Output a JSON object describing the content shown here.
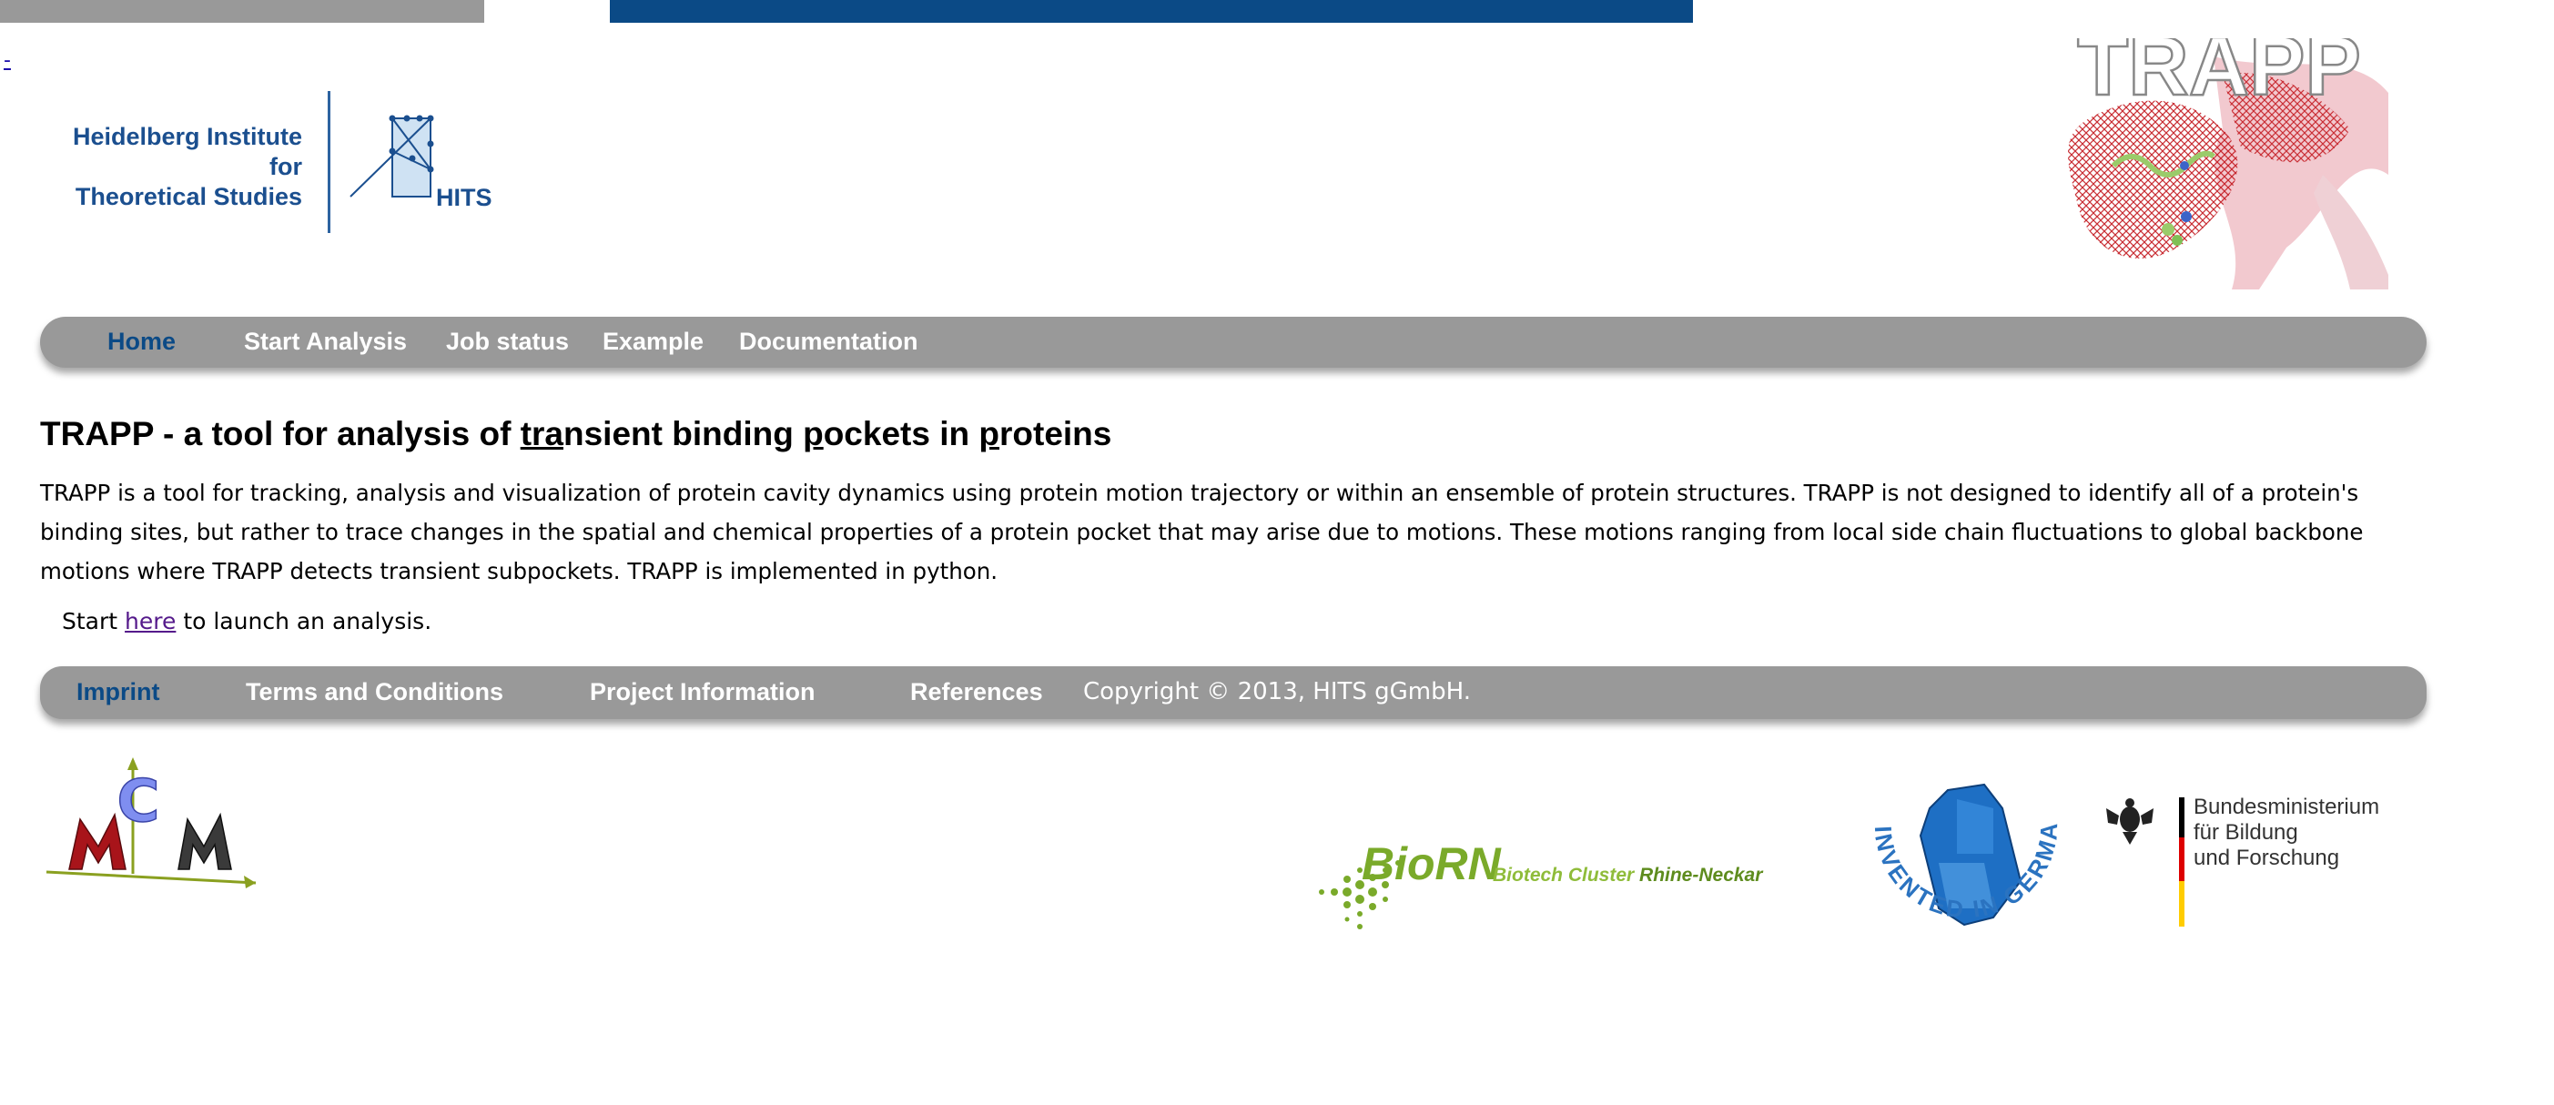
{
  "header": {
    "skip_link": "-",
    "hits_logo": {
      "line1": "Heidelberg Institute for",
      "line2": "Theoretical Studies",
      "abbrev": "HITS"
    },
    "trapp_banner": "TRAPP"
  },
  "nav": {
    "items": [
      {
        "label": "Home",
        "active": true
      },
      {
        "label": "Start Analysis",
        "active": false
      },
      {
        "label": "Job status",
        "active": false
      },
      {
        "label": "Example",
        "active": false
      },
      {
        "label": "Documentation",
        "active": false
      }
    ]
  },
  "main": {
    "title_prefix": "TRAPP - a tool for analysis of ",
    "title_u1": "tra",
    "title_mid1": "nsient binding ",
    "title_u2": "p",
    "title_mid2": "ockets in ",
    "title_u3": "p",
    "title_end": "roteins",
    "description": "TRAPP is a tool for tracking, analysis and visualization of protein cavity dynamics using protein motion trajectory or within an ensemble of protein structures. TRAPP is not designed to identify all of a protein's binding sites, but rather to trace changes in the spatial and chemical properties of a protein pocket that may arise due to motions. These motions ranging from local side chain fluctuations to global backbone motions where TRAPP detects transient subpockets. TRAPP is implemented in python.",
    "start_prefix": "Start ",
    "start_link": "here",
    "start_suffix": " to launch an analysis."
  },
  "footer": {
    "items": [
      {
        "label": "Imprint",
        "active": true
      },
      {
        "label": "Terms and Conditions",
        "active": false
      },
      {
        "label": "Project Information",
        "active": false
      },
      {
        "label": "References",
        "active": false
      }
    ],
    "copyright": "Copyright © 2013, HITS gGmbH."
  },
  "logos": {
    "mcm": "MCM",
    "biorn_name": "BioRN",
    "biorn_sub1": "Biotech Cluster ",
    "biorn_sub2": "Rhine-Neckar",
    "invented": "INVENTED IN GERMANY",
    "bmbf_line1": "Bundesministerium",
    "bmbf_line2": "für Bildung",
    "bmbf_line3": "und Forschung"
  },
  "colors": {
    "bar_grey": "#999999",
    "brand_blue": "#0b4a86",
    "visited_link": "#551a8b",
    "biorn_green": "#7aaa2a"
  }
}
